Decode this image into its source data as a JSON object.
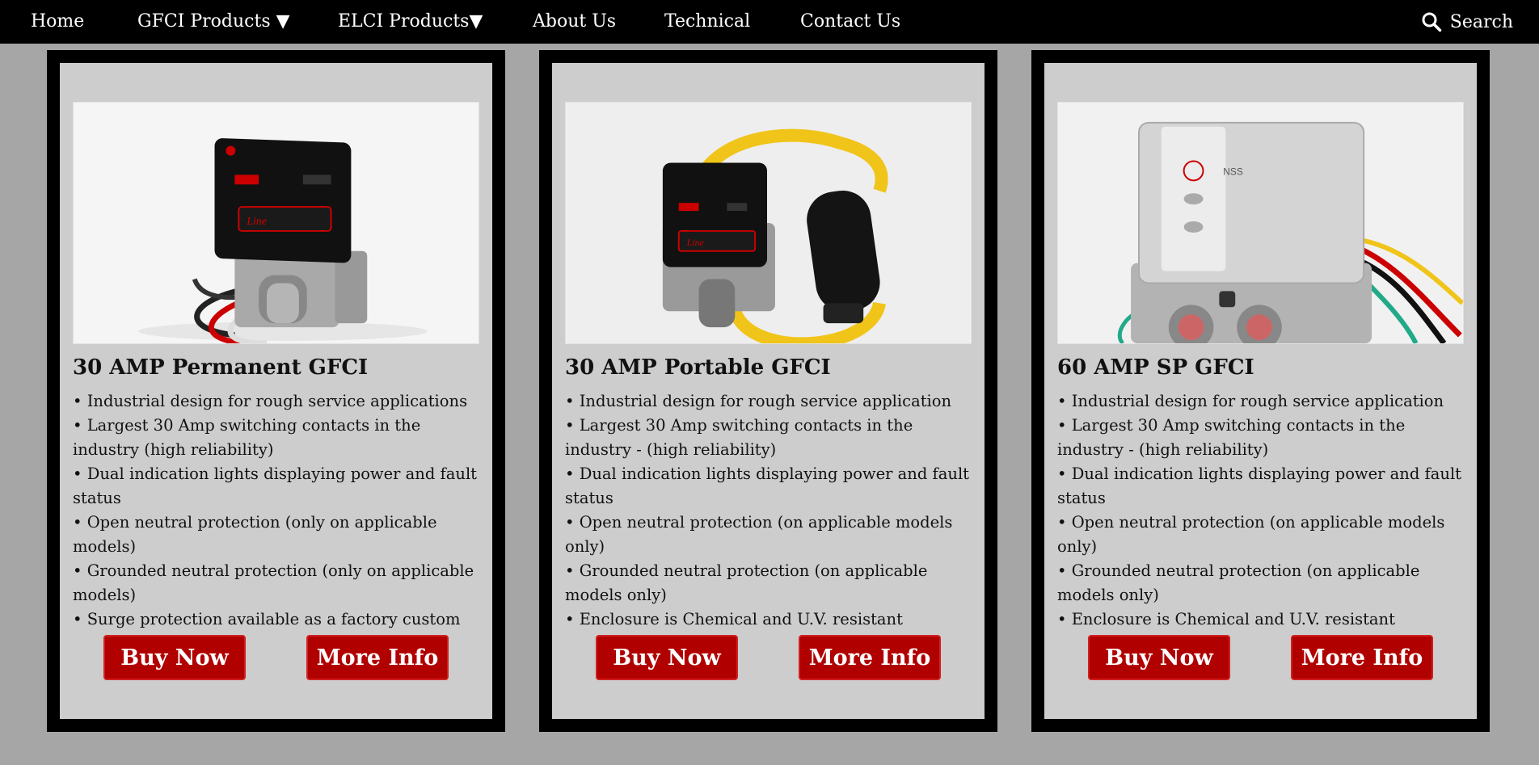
{
  "nav": {
    "items": [
      {
        "label": "Home"
      },
      {
        "label": "GFCI Products ▼"
      },
      {
        "label": "ELCI Products▼"
      },
      {
        "label": "About Us"
      },
      {
        "label": "Technical"
      },
      {
        "label": "Contact Us"
      }
    ],
    "search_label": "Search",
    "search_icon": "search-icon"
  },
  "products": [
    {
      "title": "30 AMP Permanent GFCI",
      "image_icon": "permanent-gfci-product-photo",
      "features": [
        "• Industrial design for rough service applications",
        "• Largest 30 Amp switching contacts in the industry (high reliability)",
        "• Dual indication lights displaying power and fault status",
        "• Open neutral protection (only on applicable models)",
        "• Grounded neutral protection (only on applicable models)",
        "• Surge protection available as a factory custom"
      ],
      "buy_label": "Buy Now",
      "more_label": "More Info"
    },
    {
      "title": "30 AMP Portable GFCI",
      "image_icon": "portable-gfci-product-photo",
      "features": [
        "• Industrial design for rough service application",
        "• Largest 30 Amp switching contacts in the industry - (high reliability)",
        "• Dual indication lights displaying power and fault status",
        "• Open neutral protection (on applicable models only)",
        "• Grounded neutral protection (on applicable models only)",
        "• Enclosure is Chemical and U.V. resistant"
      ],
      "buy_label": "Buy Now",
      "more_label": "More Info"
    },
    {
      "title": "60 AMP SP GFCI",
      "image_icon": "sp-gfci-product-photo",
      "features": [
        "• Industrial design for rough service application",
        "• Largest 30 Amp switching contacts in the industry - (high reliability)",
        "• Dual indication lights displaying power and fault status",
        "• Open neutral protection (on applicable models only)",
        "• Grounded neutral protection (on applicable models only)",
        "• Enclosure is Chemical and U.V. resistant"
      ],
      "buy_label": "Buy Now",
      "more_label": "More Info"
    }
  ],
  "colors": {
    "nav_bg": "#000000",
    "page_bg": "#a6a6a6",
    "card_bg": "#cdcdcd",
    "button_bg": "#b00000"
  }
}
